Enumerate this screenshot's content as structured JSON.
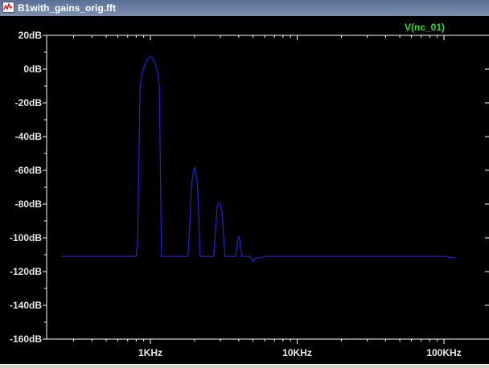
{
  "window": {
    "title": "B1with_gains_orig.fft",
    "icon": "waveform-icon"
  },
  "colors": {
    "background": "#000000",
    "axis": "#ffffff",
    "trace": "#2020d8",
    "trace_label": "#2ee02e"
  },
  "chart_data": {
    "type": "line",
    "title": "",
    "xlabel": "",
    "ylabel": "",
    "x_scale": "log",
    "xlim": [
      250,
      120000
    ],
    "ylim": [
      -160,
      20
    ],
    "grid": false,
    "legend_position": "top-right",
    "y_ticks": [
      "20dB",
      "0dB",
      "-20dB",
      "-40dB",
      "-60dB",
      "-80dB",
      "-100dB",
      "-120dB",
      "-140dB",
      "-160dB"
    ],
    "y_tick_values": [
      20,
      0,
      -20,
      -40,
      -60,
      -80,
      -100,
      -120,
      -140,
      -160
    ],
    "x_ticks": [
      "1KHz",
      "10KHz",
      "100KHz"
    ],
    "x_tick_values": [
      1000,
      10000,
      100000
    ],
    "series": [
      {
        "name": "V(nc_01)",
        "x": [
          250,
          800,
          820,
          850,
          880,
          920,
          960,
          1000,
          1040,
          1080,
          1120,
          1150,
          1190,
          1800,
          1850,
          1900,
          1950,
          2000,
          2050,
          2100,
          2150,
          2180,
          2700,
          2780,
          2850,
          2920,
          3000,
          3080,
          3150,
          3220,
          3300,
          3500,
          3800,
          3880,
          3950,
          4000,
          4050,
          4120,
          4200,
          4400,
          4800,
          5000,
          5200,
          5600,
          6000,
          8000,
          10000,
          20000,
          50000,
          100000,
          120000
        ],
        "y": [
          -111,
          -111,
          -100,
          -10,
          -2,
          3,
          6,
          7.5,
          6,
          3,
          -2,
          -10,
          -111,
          -111,
          -95,
          -70,
          -63,
          -58,
          -63,
          -70,
          -95,
          -111,
          -111,
          -95,
          -82,
          -79,
          -80,
          -85,
          -98,
          -111,
          -111,
          -111,
          -111,
          -106,
          -101,
          -99,
          -101,
          -106,
          -111,
          -111,
          -111,
          -114,
          -112,
          -112,
          -111,
          -111,
          -111,
          -111,
          -111,
          -111,
          -112
        ]
      }
    ]
  }
}
